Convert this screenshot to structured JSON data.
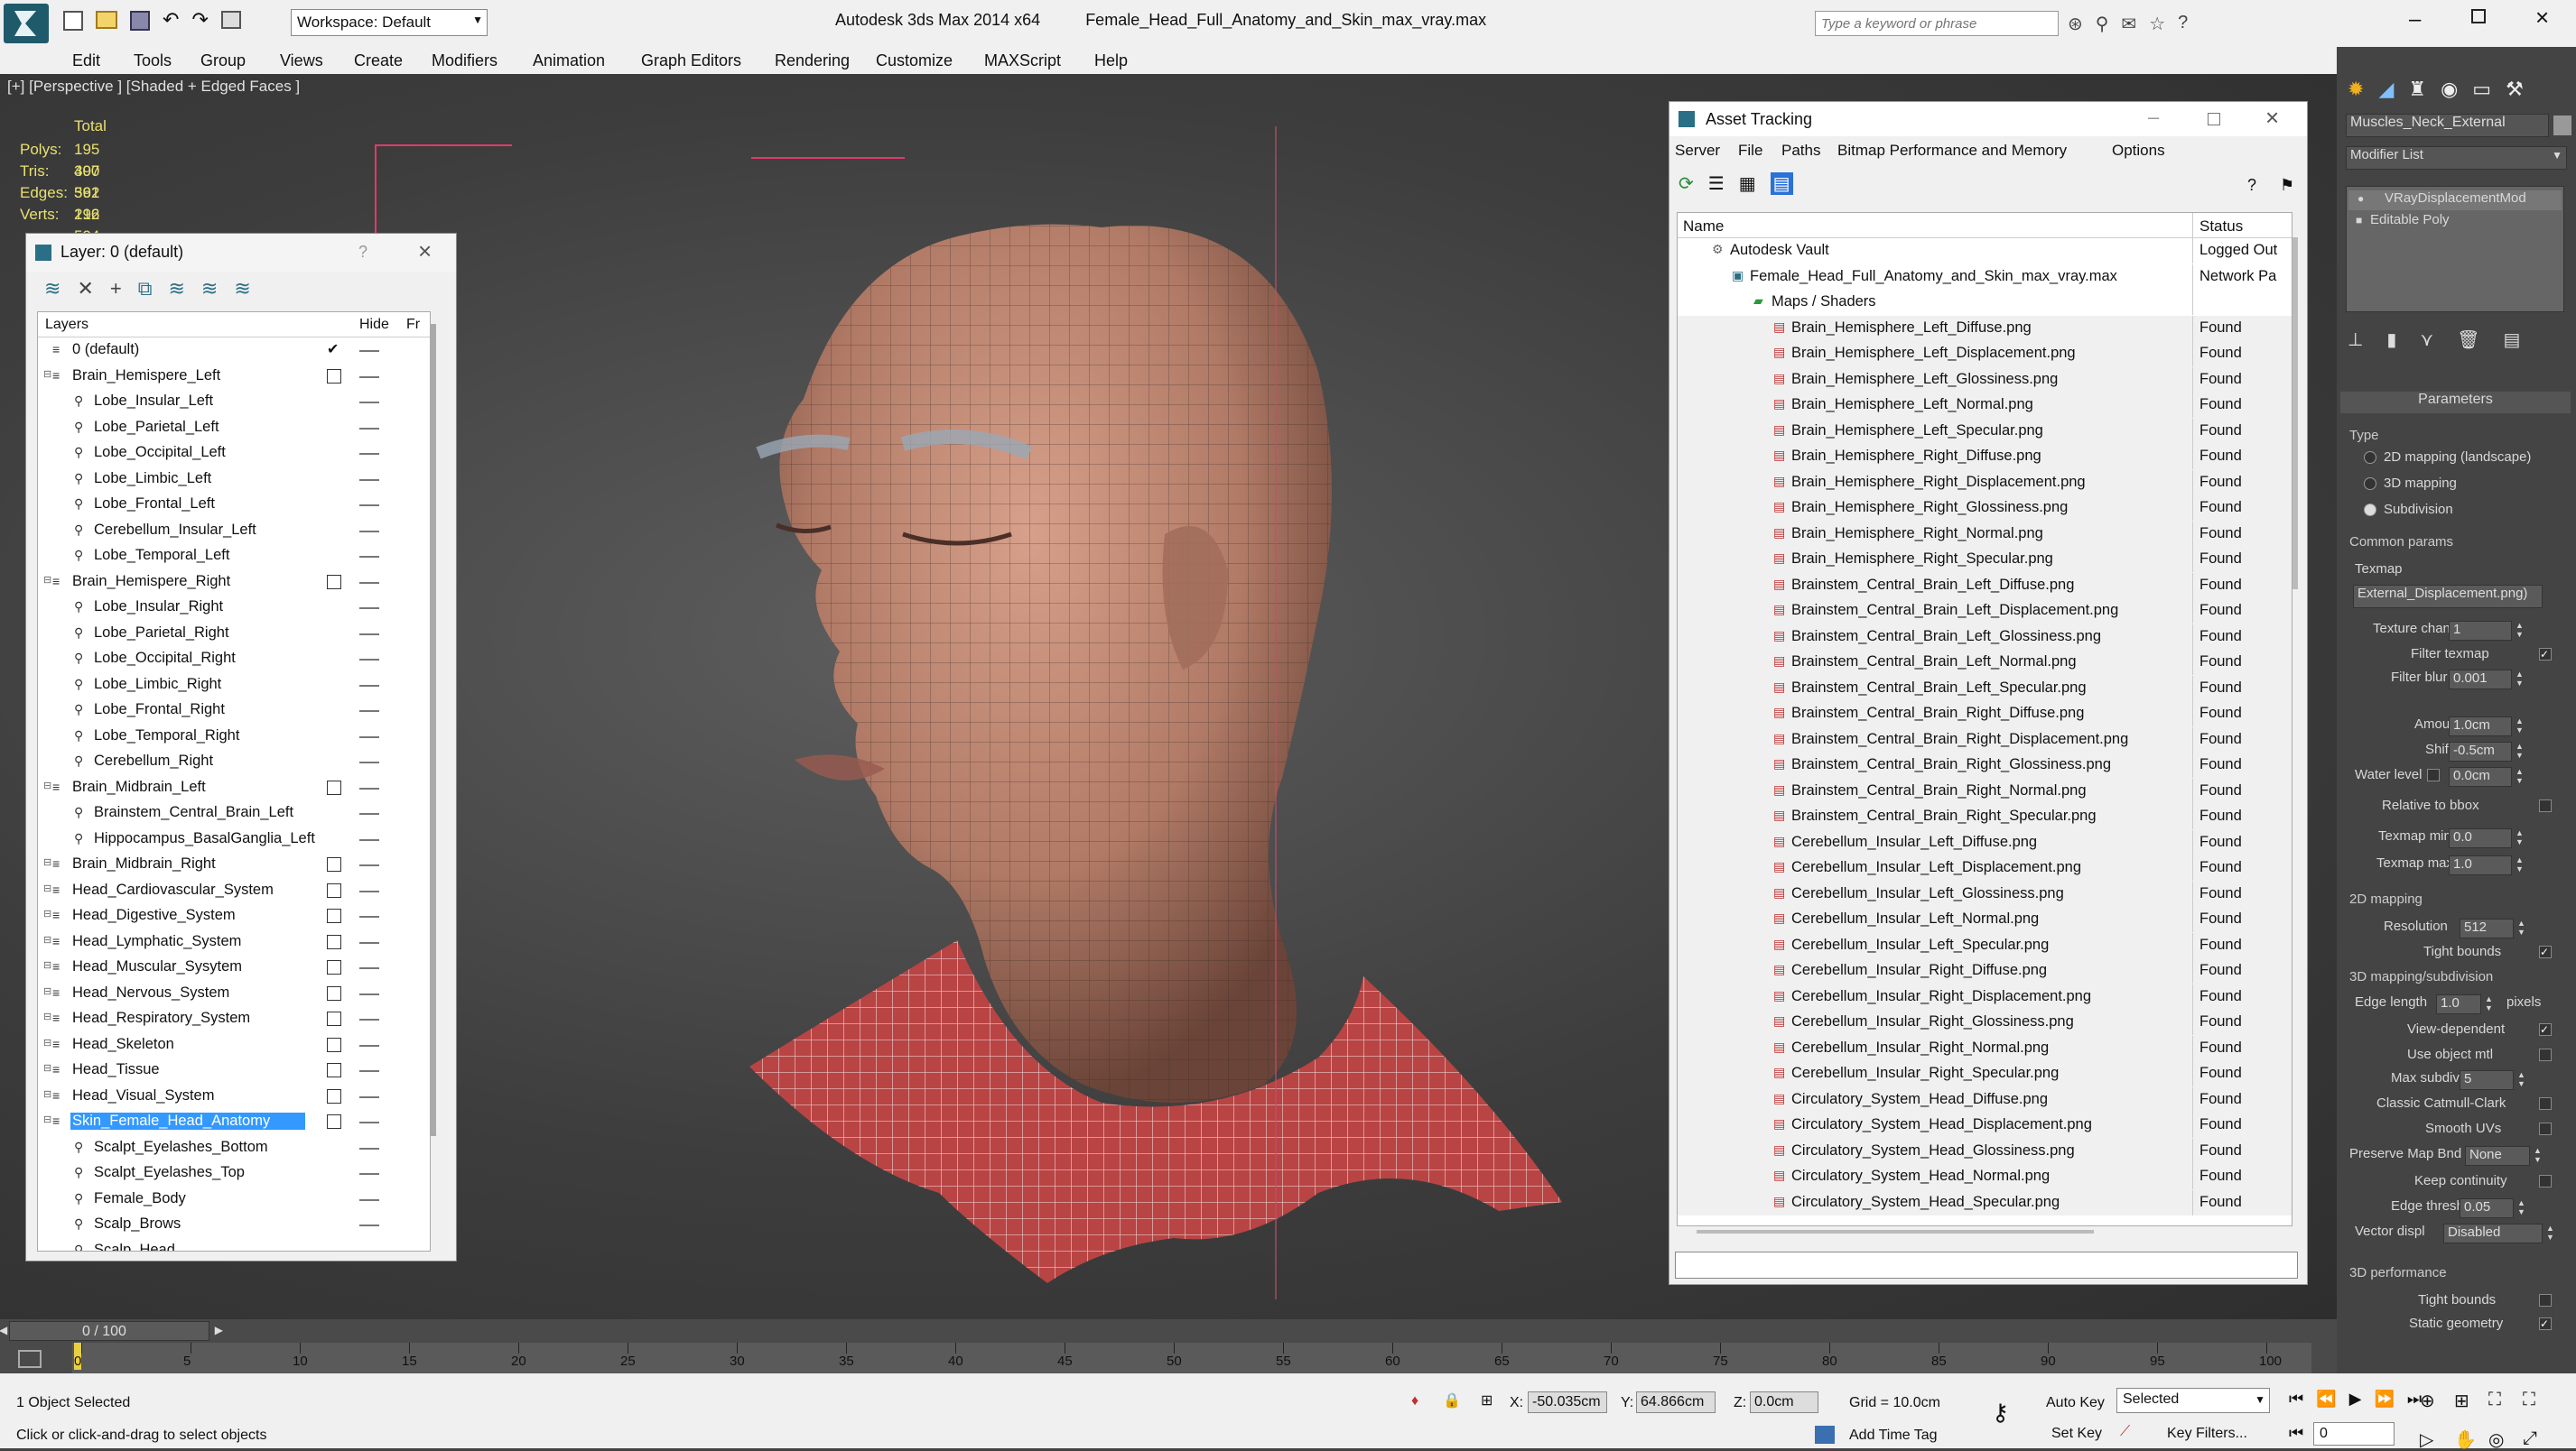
{
  "app": {
    "title": "Autodesk 3ds Max  2014 x64",
    "file": "Female_Head_Full_Anatomy_and_Skin_max_vray.max",
    "workspace": "Workspace: Default",
    "search_placeholder": "Type a keyword or phrase"
  },
  "menu": [
    "Edit",
    "Tools",
    "Group",
    "Views",
    "Create",
    "Modifiers",
    "Animation",
    "Graph Editors",
    "Rendering",
    "Customize",
    "MAXScript",
    "Help"
  ],
  "viewport": {
    "label": "[+] [Perspective ] [Shaded + Edged Faces ]",
    "stats": {
      "total": "Total",
      "polys_label": "Polys:",
      "polys": "195 407",
      "tris_label": "Tris:",
      "tris": "390 562",
      "edges_label": "Edges:",
      "edges": "391 212",
      "verts_label": "Verts:",
      "verts": "196 594"
    }
  },
  "layer_window": {
    "title": "Layer: 0 (default)",
    "help": "?",
    "col_layers": "Layers",
    "col_hide": "Hide",
    "col_fr": "Fr",
    "rows": [
      {
        "label": "0 (default)",
        "indent": 0,
        "check": true
      },
      {
        "label": "Brain_Hemispere_Left",
        "indent": 0,
        "box": true
      },
      {
        "label": "Lobe_Insular_Left",
        "indent": 1
      },
      {
        "label": "Lobe_Parietal_Left",
        "indent": 1
      },
      {
        "label": "Lobe_Occipital_Left",
        "indent": 1
      },
      {
        "label": "Lobe_Limbic_Left",
        "indent": 1
      },
      {
        "label": "Lobe_Frontal_Left",
        "indent": 1
      },
      {
        "label": "Cerebellum_Insular_Left",
        "indent": 1
      },
      {
        "label": "Lobe_Temporal_Left",
        "indent": 1
      },
      {
        "label": "Brain_Hemispere_Right",
        "indent": 0,
        "box": true
      },
      {
        "label": "Lobe_Insular_Right",
        "indent": 1
      },
      {
        "label": "Lobe_Parietal_Right",
        "indent": 1
      },
      {
        "label": "Lobe_Occipital_Right",
        "indent": 1
      },
      {
        "label": "Lobe_Limbic_Right",
        "indent": 1
      },
      {
        "label": "Lobe_Frontal_Right",
        "indent": 1
      },
      {
        "label": "Lobe_Temporal_Right",
        "indent": 1
      },
      {
        "label": "Cerebellum_Right",
        "indent": 1
      },
      {
        "label": "Brain_Midbrain_Left",
        "indent": 0,
        "box": true
      },
      {
        "label": "Brainstem_Central_Brain_Left",
        "indent": 1
      },
      {
        "label": "Hippocampus_BasalGanglia_Left",
        "indent": 1
      },
      {
        "label": "Brain_Midbrain_Right",
        "indent": 0,
        "box": true
      },
      {
        "label": "Head_Cardiovascular_System",
        "indent": 0,
        "box": true
      },
      {
        "label": "Head_Digestive_System",
        "indent": 0,
        "box": true
      },
      {
        "label": "Head_Lymphatic_System",
        "indent": 0,
        "box": true
      },
      {
        "label": "Head_Muscular_Sysytem",
        "indent": 0,
        "box": true
      },
      {
        "label": "Head_Nervous_System",
        "indent": 0,
        "box": true
      },
      {
        "label": "Head_Respiratory_System",
        "indent": 0,
        "box": true
      },
      {
        "label": "Head_Skeleton",
        "indent": 0,
        "box": true
      },
      {
        "label": "Head_Tissue",
        "indent": 0,
        "box": true
      },
      {
        "label": "Head_Visual_System",
        "indent": 0,
        "box": true
      },
      {
        "label": "Skin_Female_Head_Anatomy",
        "indent": 0,
        "box": true,
        "selected": true
      },
      {
        "label": "Scalpt_Eyelashes_Bottom",
        "indent": 1
      },
      {
        "label": "Scalpt_Eyelashes_Top",
        "indent": 1
      },
      {
        "label": "Female_Body",
        "indent": 1
      },
      {
        "label": "Scalp_Brows",
        "indent": 1
      },
      {
        "label": "Scalp_Head",
        "indent": 1
      }
    ]
  },
  "asset_window": {
    "title": "Asset Tracking",
    "menu": [
      "Server",
      "File",
      "Paths",
      "Bitmap Performance and Memory",
      "Options"
    ],
    "col_name": "Name",
    "col_status": "Status",
    "vault": {
      "name": "Autodesk Vault",
      "status": "Logged Out"
    },
    "file": {
      "name": "Female_Head_Full_Anatomy_and_Skin_max_vray.max",
      "status": "Network Pa"
    },
    "maps_label": "Maps / Shaders",
    "found": "Found",
    "files": [
      "Brain_Hemisphere_Left_Diffuse.png",
      "Brain_Hemisphere_Left_Displacement.png",
      "Brain_Hemisphere_Left_Glossiness.png",
      "Brain_Hemisphere_Left_Normal.png",
      "Brain_Hemisphere_Left_Specular.png",
      "Brain_Hemisphere_Right_Diffuse.png",
      "Brain_Hemisphere_Right_Displacement.png",
      "Brain_Hemisphere_Right_Glossiness.png",
      "Brain_Hemisphere_Right_Normal.png",
      "Brain_Hemisphere_Right_Specular.png",
      "Brainstem_Central_Brain_Left_Diffuse.png",
      "Brainstem_Central_Brain_Left_Displacement.png",
      "Brainstem_Central_Brain_Left_Glossiness.png",
      "Brainstem_Central_Brain_Left_Normal.png",
      "Brainstem_Central_Brain_Left_Specular.png",
      "Brainstem_Central_Brain_Right_Diffuse.png",
      "Brainstem_Central_Brain_Right_Displacement.png",
      "Brainstem_Central_Brain_Right_Glossiness.png",
      "Brainstem_Central_Brain_Right_Normal.png",
      "Brainstem_Central_Brain_Right_Specular.png",
      "Cerebellum_Insular_Left_Diffuse.png",
      "Cerebellum_Insular_Left_Displacement.png",
      "Cerebellum_Insular_Left_Glossiness.png",
      "Cerebellum_Insular_Left_Normal.png",
      "Cerebellum_Insular_Left_Specular.png",
      "Cerebellum_Insular_Right_Diffuse.png",
      "Cerebellum_Insular_Right_Displacement.png",
      "Cerebellum_Insular_Right_Glossiness.png",
      "Cerebellum_Insular_Right_Normal.png",
      "Cerebellum_Insular_Right_Specular.png",
      "Circulatory_System_Head_Diffuse.png",
      "Circulatory_System_Head_Displacement.png",
      "Circulatory_System_Head_Glossiness.png",
      "Circulatory_System_Head_Normal.png",
      "Circulatory_System_Head_Specular.png"
    ]
  },
  "command_panel": {
    "object_name": "Muscles_Neck_External",
    "modifier_list": "Modifier List",
    "stack": [
      "VRayDisplacementMod",
      "Editable Poly"
    ],
    "rollout": "Parameters",
    "type_label": "Type",
    "type_options": [
      "2D mapping (landscape)",
      "3D mapping",
      "Subdivision"
    ],
    "common_params": "Common params",
    "texmap_label": "Texmap",
    "texmap": "External_Displacement.png)",
    "texture_chan_label": "Texture chan",
    "texture_chan": "1",
    "filter_texmap": "Filter texmap",
    "filter_blur_label": "Filter blur",
    "filter_blur": "0.001",
    "amount_label": "Amount",
    "amount": "1.0cm",
    "shift_label": "Shift",
    "shift": "-0.5cm",
    "water_label": "Water level",
    "water": "0.0cm",
    "relative": "Relative to bbox",
    "texmap_min_label": "Texmap min",
    "texmap_min": "0.0",
    "texmap_max_label": "Texmap max",
    "texmap_max": "1.0",
    "mapping2d": "2D mapping",
    "resolution_label": "Resolution",
    "resolution": "512",
    "tight_bounds": "Tight bounds",
    "mapping3d": "3D mapping/subdivision",
    "edge_length_label": "Edge length",
    "edge_length": "1.0",
    "pixels": "pixels",
    "view_dependent": "View-dependent",
    "use_object_mtl": "Use object mtl",
    "max_subdivs_label": "Max subdivs",
    "max_subdivs": "5",
    "catmull": "Classic Catmull-Clark",
    "smooth_uvs": "Smooth UVs",
    "preserve_label": "Preserve Map Bnd",
    "preserve": "None",
    "keep_continuity": "Keep continuity",
    "edge_thresh_label": "Edge thresh",
    "edge_thresh": "0.05",
    "vector_label": "Vector displ",
    "vector": "Disabled",
    "performance": "3D performance",
    "tight_bounds2": "Tight bounds",
    "static_geometry": "Static geometry"
  },
  "timeline": {
    "frame": "0 / 100",
    "ticks": [
      "0",
      "5",
      "10",
      "15",
      "20",
      "25",
      "30",
      "35",
      "40",
      "45",
      "50",
      "55",
      "60",
      "65",
      "70",
      "75",
      "80",
      "85",
      "90",
      "95",
      "100"
    ]
  },
  "status": {
    "selection": "1 Object Selected",
    "prompt": "Click or click-and-drag to select objects",
    "x_label": "X:",
    "x": "-50.035cm",
    "y_label": "Y:",
    "y": "64.866cm",
    "z_label": "Z:",
    "z": "0.0cm",
    "grid": "Grid = 10.0cm",
    "auto_key": "Auto Key",
    "selected": "Selected",
    "set_key": "Set Key",
    "key_filters": "Key Filters...",
    "add_time_tag": "Add Time Tag",
    "frame_field": "0"
  },
  "colors": {
    "selection": "#3399ff",
    "stat_text": "#e8e070",
    "skin": "#c9907a",
    "accent_red": "#c84a4a"
  }
}
